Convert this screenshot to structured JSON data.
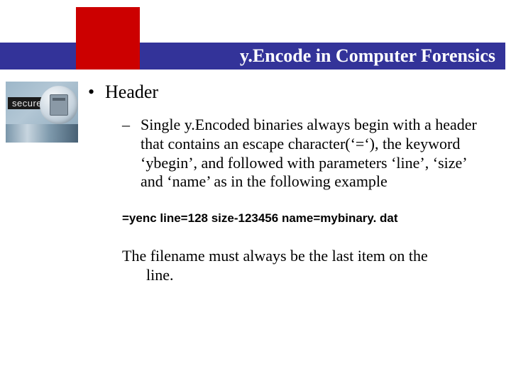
{
  "header": {
    "title": "y.Encode in Computer Forensics"
  },
  "secure": {
    "label": "secure"
  },
  "content": {
    "bullet1": "Header",
    "bullet2": "Single y.Encoded binaries always begin with a header that contains an escape character(‘=‘), the keyword ‘ybegin’, and followed with parameters ‘line’, ‘size’ and ‘name’ as in the following example",
    "code": "=yenc line=128 size-123456 name=mybinary. dat",
    "trailing_first": "The filename must always be the last item on the",
    "trailing_rest": "line."
  }
}
